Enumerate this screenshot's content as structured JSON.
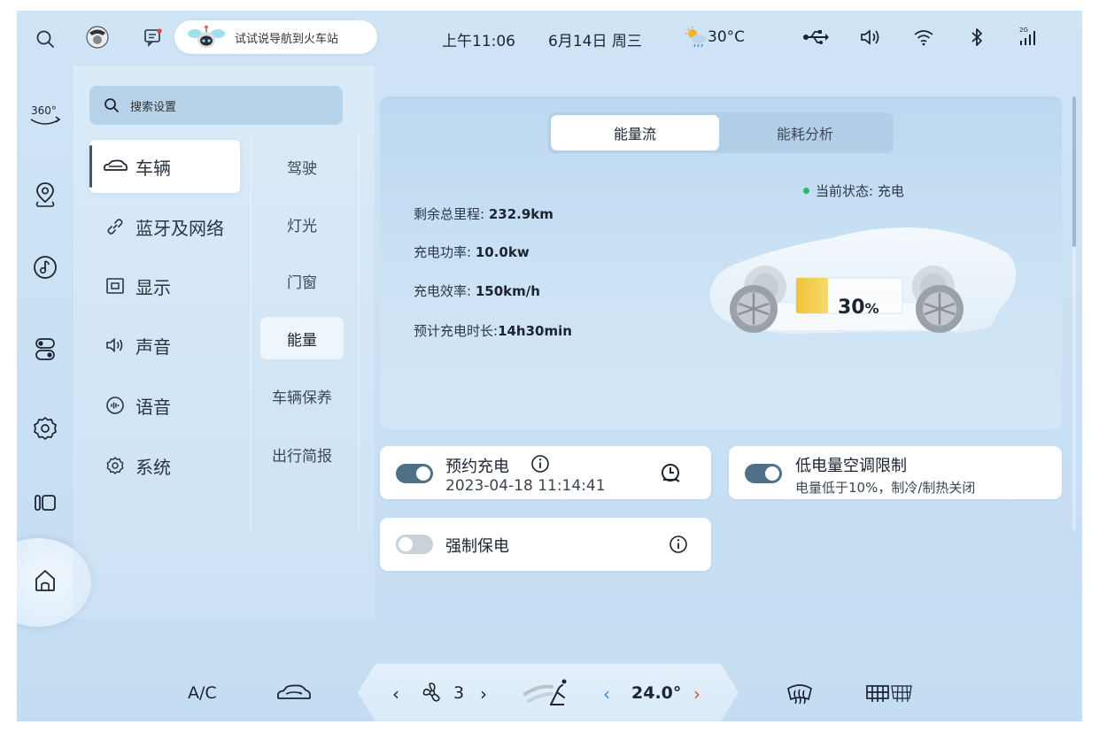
{
  "status_bar": {
    "voice_hint": "试试说导航到火车站",
    "time": "上午11:06",
    "date": "6月14日 周三",
    "weather_temp": "30°C",
    "signal_label": "2G"
  },
  "left_rail": {
    "camera_label": "360°"
  },
  "search": {
    "placeholder": "搜索设置"
  },
  "menu": {
    "items": [
      {
        "label": "车辆",
        "icon": "car-icon",
        "active": true
      },
      {
        "label": "蓝牙及网络",
        "icon": "link-icon"
      },
      {
        "label": "显示",
        "icon": "display-icon"
      },
      {
        "label": "声音",
        "icon": "speaker-icon"
      },
      {
        "label": "语音",
        "icon": "voice-icon"
      },
      {
        "label": "系统",
        "icon": "gear-icon"
      }
    ],
    "sub_items": [
      {
        "label": "驾驶"
      },
      {
        "label": "灯光"
      },
      {
        "label": "门窗"
      },
      {
        "label": "能量",
        "active": true
      },
      {
        "label": "车辆保养"
      },
      {
        "label": "出行简报"
      }
    ]
  },
  "energy": {
    "tabs": [
      "能量流",
      "能耗分析"
    ],
    "active_tab": "能量流",
    "range_label": "剩余总里程:",
    "range_value": "232.9km",
    "power_label": "充电功率:",
    "power_value": "10.0kw",
    "efficiency_label": "充电效率:",
    "efficiency_value": "150km/h",
    "duration_label": "预计充电时长:",
    "duration_value": "14h30min",
    "state_label": "当前状态:",
    "state_value": "充电",
    "battery_percent": "30",
    "battery_unit": "%",
    "battery_level": 0.3
  },
  "scheduled_charge": {
    "title": "预约充电",
    "datetime": "2023-04-18   11:14:41",
    "enabled": true
  },
  "low_battery_ac": {
    "title": "低电量空调限制",
    "desc": "电量低于10%，制冷/制热关闭",
    "enabled": true
  },
  "force_preserve": {
    "title": "强制保电",
    "enabled": false
  },
  "bottom_bar": {
    "ac_label": "A/C",
    "fan_level": "3",
    "temperature": "24.0°"
  },
  "colors": {
    "accent": "#4e7187",
    "charge_dot": "#2fb36b",
    "temp_arrow_left": "#2b8bd6",
    "temp_arrow_right": "#e04a3c"
  }
}
